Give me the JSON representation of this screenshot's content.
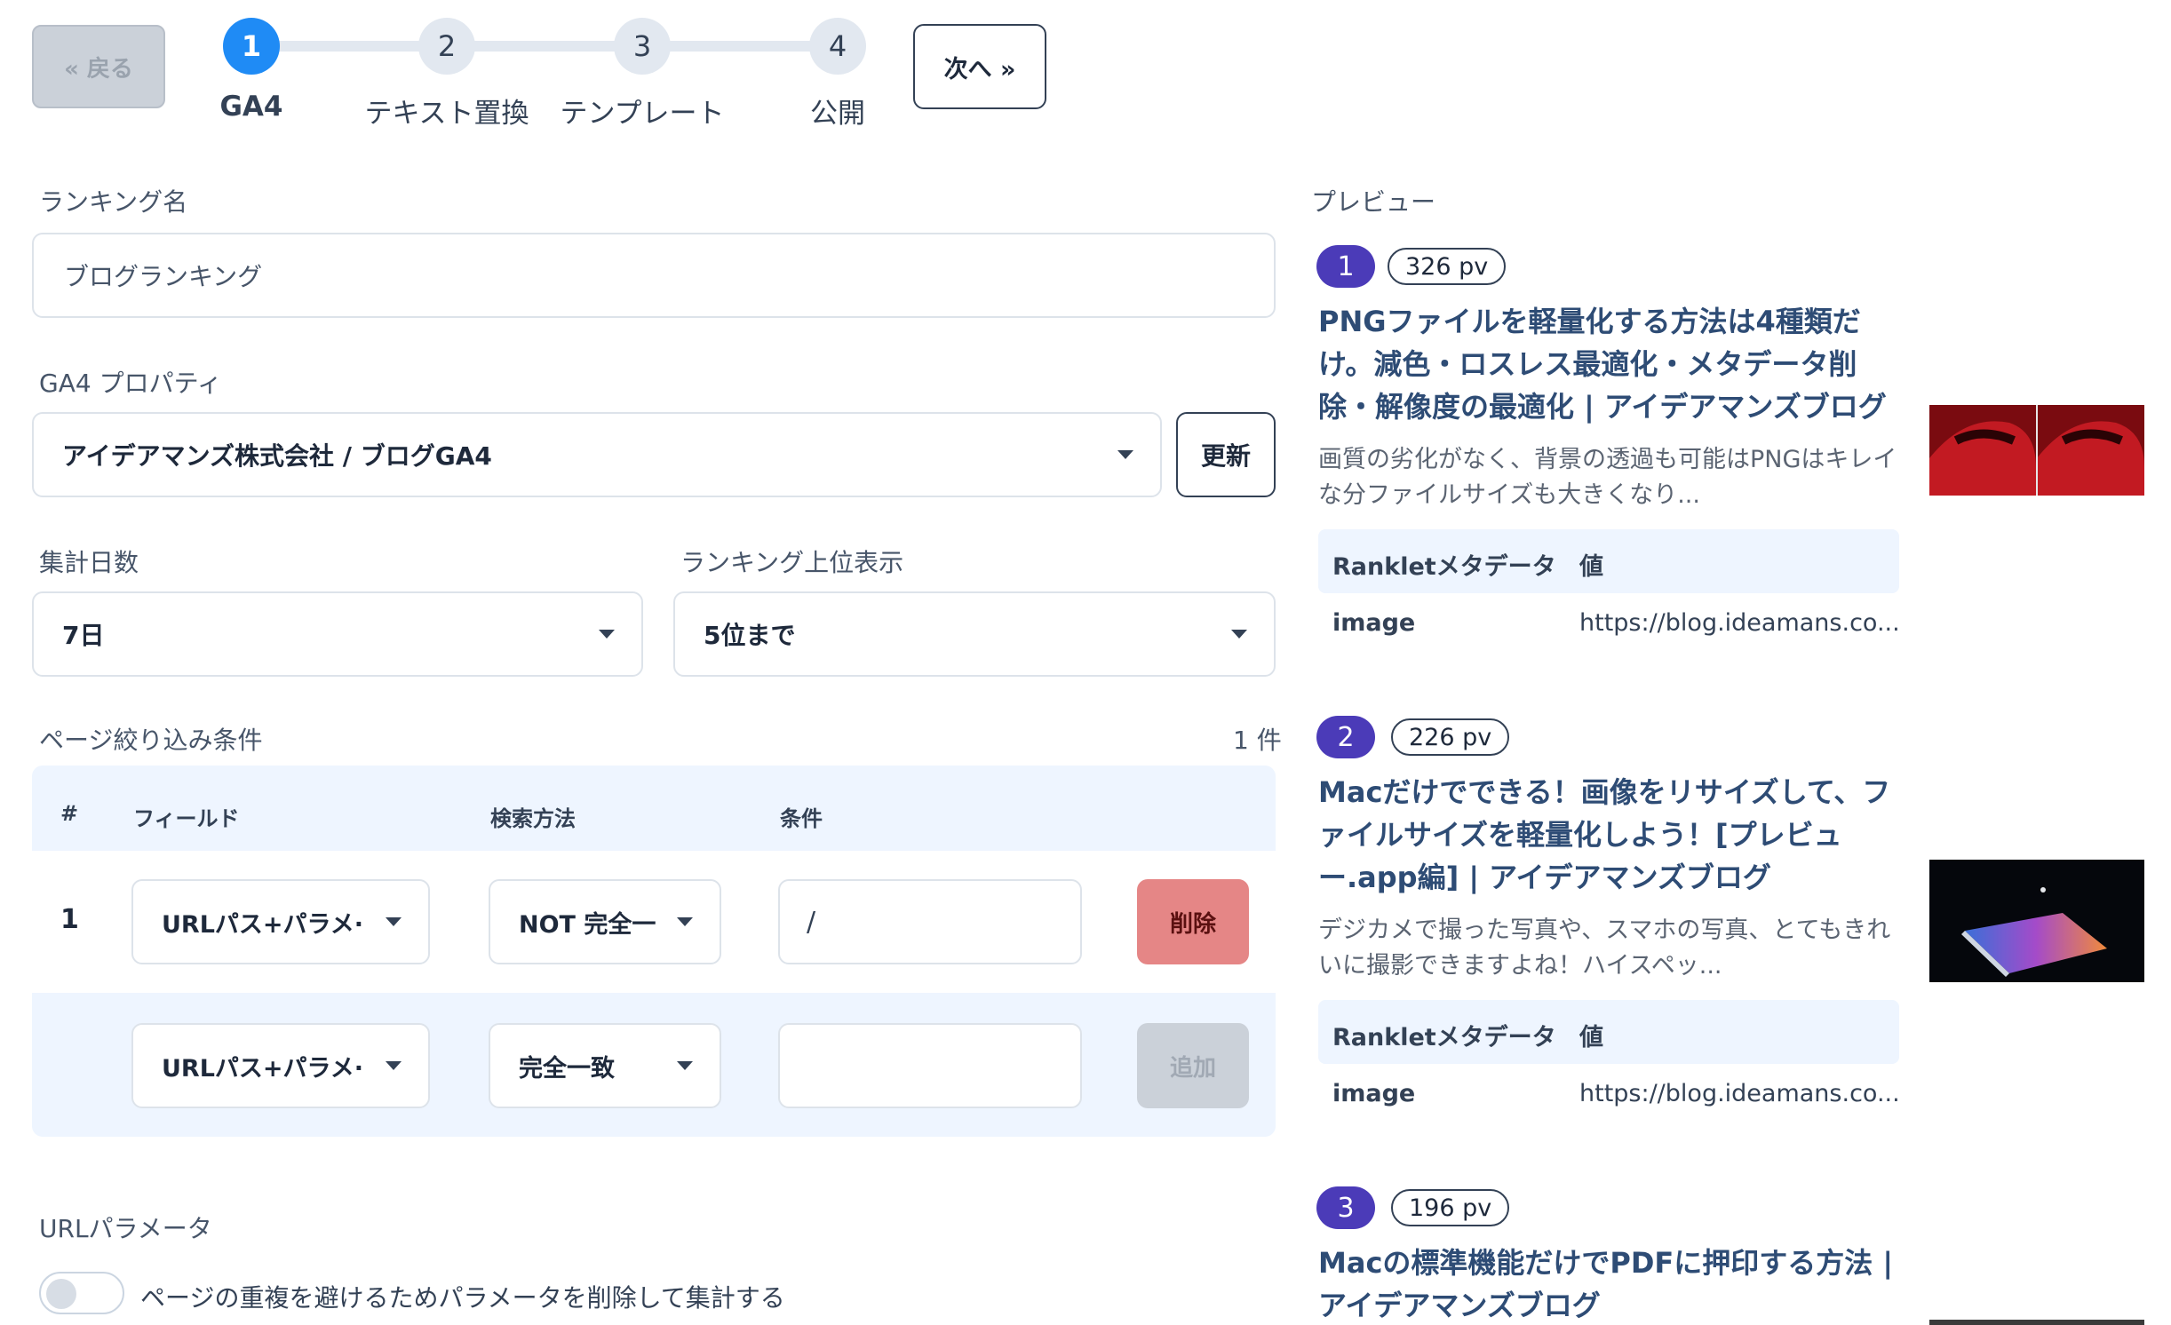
{
  "nav": {
    "back_label": "« 戻る",
    "next_label": "次へ »",
    "steps": [
      {
        "number": "1",
        "label": "GA4"
      },
      {
        "number": "2",
        "label": "テキスト置換"
      },
      {
        "number": "3",
        "label": "テンプレート"
      },
      {
        "number": "4",
        "label": "公開"
      }
    ]
  },
  "form": {
    "ranking_name_label": "ランキング名",
    "ranking_name_value": "ブログランキング",
    "property_label": "GA4 プロパティ",
    "property_value": "アイデアマンズ株式会社 / ブログGA4",
    "refresh_label": "更新",
    "days_label": "集計日数",
    "days_value": "7日",
    "top_label": "ランキング上位表示",
    "top_value": "5位まで"
  },
  "filters": {
    "section_label": "ページ絞り込み条件",
    "count": "1 件",
    "headers": {
      "num": "#",
      "field": "フィールド",
      "method": "検索方法",
      "condition": "条件"
    },
    "rows": [
      {
        "num": "1",
        "field": "URLパス+パラメ·",
        "method": "NOT 完全一",
        "condition": "/",
        "action": "削除"
      }
    ],
    "new_row": {
      "field": "URLパス+パラメ·",
      "method": "完全一致",
      "condition": "",
      "action": "追加"
    }
  },
  "url_params": {
    "label": "URLパラメータ",
    "toggle_label": "ページの重複を避けるためパラメータを削除して集計する"
  },
  "preview": {
    "label": "プレビュー",
    "meta_header_key": "Rankletメタデータ",
    "meta_header_val": "値",
    "articles": [
      {
        "rank": "1",
        "pv": "326 pv",
        "title": "PNGファイルを軽量化する方法は4種類だけ。減色・ロスレス最適化・メタデータ削除・解像度の最適化 | アイデアマンズブログ",
        "desc": "画質の劣化がなく、背景の透過も可能はPNGはキレイな分ファイルサイズも大きくなり...",
        "meta_key": "image",
        "meta_val": "https://blog.ideamans.co..."
      },
      {
        "rank": "2",
        "pv": "226 pv",
        "title": "Macだけでできる！画像をリサイズして、ファイルサイズを軽量化しよう！[プレビュー.app編] | アイデアマンズブログ",
        "desc": "デジカメで撮った写真や、スマホの写真、とてもきれいに撮影できますよね！ハイスペッ...",
        "meta_key": "image",
        "meta_val": "https://blog.ideamans.co..."
      },
      {
        "rank": "3",
        "pv": "196 pv",
        "title": "Macの標準機能だけでPDFに押印する方法 | アイデアマンズブログ"
      }
    ]
  },
  "colors": {
    "accent": "#1f8bf5",
    "rank_badge": "#4b3bb8",
    "title_link": "#2e4c75",
    "delete": "#e58686",
    "table_bg": "#eef5ff"
  }
}
